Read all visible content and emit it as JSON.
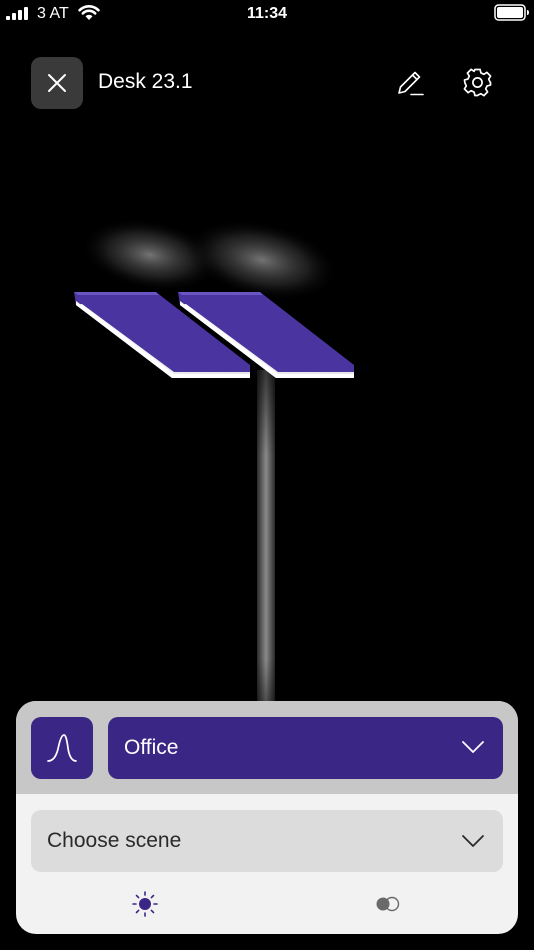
{
  "status_bar": {
    "carrier": "3 AT",
    "time": "11:34"
  },
  "header": {
    "title": "Desk 23.1",
    "close_icon": "close-icon",
    "edit_icon": "pencil-icon",
    "settings_icon": "gear-icon"
  },
  "panel": {
    "mode": {
      "selected": "Office",
      "icon": "light-curve-icon"
    },
    "scene": {
      "placeholder": "Choose scene"
    },
    "tabs": [
      {
        "icon": "brightness-icon",
        "active": true
      },
      {
        "icon": "color-temperature-icon",
        "active": false
      }
    ]
  },
  "colors": {
    "background": "#000000",
    "accent": "#3a2785",
    "lamp_edge": "#4a34a0",
    "panel_top": "#c7c7c7",
    "panel_bottom": "#f2f2f2",
    "dropdown_gray": "#dcdcdc",
    "close_button": "#3a3a3a"
  }
}
